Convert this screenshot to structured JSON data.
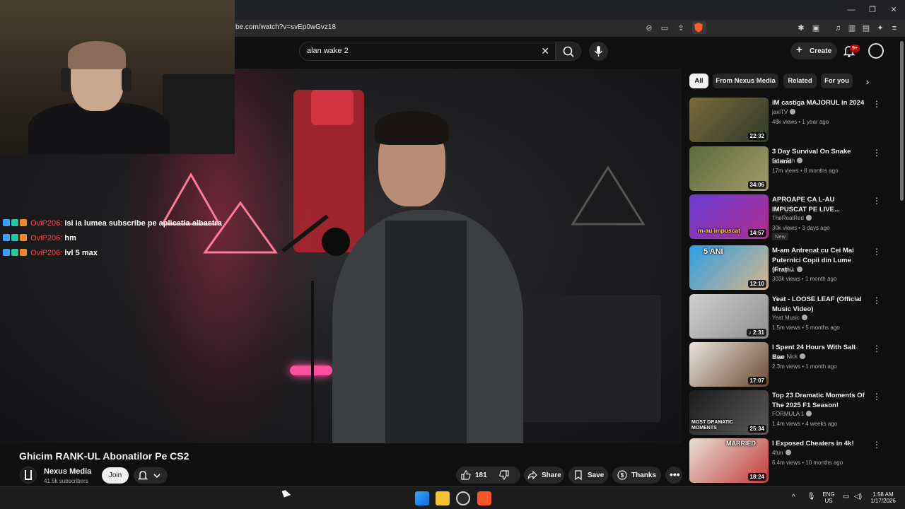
{
  "browser": {
    "url": "be.com/watch?v=svEp0wGvz18"
  },
  "search": {
    "query": "alan wake 2"
  },
  "header": {
    "create_label": "Create",
    "notification_count": "9+"
  },
  "chat": [
    {
      "user": "OviP206:",
      "message": "isi ia lumea subscribe pe aplicatia albastra"
    },
    {
      "user": "OviP206:",
      "message": "hm"
    },
    {
      "user": "OviP206:",
      "message": "lvl 5 max"
    }
  ],
  "video": {
    "title": "Ghicim RANK-UL Abonatilor Pe CS2",
    "channel": "Nexus Media",
    "subscribers": "41.5k subscribers",
    "join_label": "Join",
    "likes": "181",
    "share_label": "Share",
    "save_label": "Save",
    "thanks_label": "Thanks"
  },
  "chips": [
    {
      "label": "All"
    },
    {
      "label": "From Nexus Media"
    },
    {
      "label": "Related"
    },
    {
      "label": "For you"
    }
  ],
  "recommendations": [
    {
      "title": "iM castiga MAJORUL in 2024",
      "channel": "jaxiTV",
      "meta": "48k views • 1 year ago",
      "duration": "22:32",
      "thumb_colors": [
        "#7a6a3a",
        "#2f3a2a"
      ]
    },
    {
      "title": "3 Day Survival On Snake Island",
      "channel": "Dara Tah",
      "meta": "17m views • 8 months ago",
      "duration": "34:06",
      "thumb_colors": [
        "#5c6b3a",
        "#a39a6a"
      ]
    },
    {
      "title": "APROAPE CA L-AU IMPUSCAT PE LIVE...",
      "channel": "TheRealRed",
      "meta": "30k views • 3 days ago",
      "duration": "14:57",
      "thumb_colors": [
        "#6a3bd6",
        "#b02f8e"
      ],
      "overlay_text": "m-au impuscat",
      "new_label": "New"
    },
    {
      "title": "M-am Antrenat cu Cei Mai Puternici Copii din Lume (Frați...",
      "channel": "tony saik",
      "meta": "303k views • 1 month ago",
      "duration": "12:10",
      "thumb_colors": [
        "#2aa0e6",
        "#d9b48a"
      ],
      "overlay_text": "5 ANI"
    },
    {
      "title": "Yeat - LOOSE LEAF (Official Music Video)",
      "channel": "Yeat Music",
      "meta": "1.5m views • 5 months ago",
      "duration": "2:31",
      "thumb_colors": [
        "#cfcfcf",
        "#8f8f8f"
      ]
    },
    {
      "title": "I Spent 24 Hours With Salt Bae",
      "channel": "More Nick",
      "meta": "2.3m views • 1 month ago",
      "duration": "17:07",
      "thumb_colors": [
        "#e9e4dc",
        "#6b4a34"
      ]
    },
    {
      "title": "Top 23 Dramatic Moments Of The 2025 F1 Season!",
      "channel": "FORMULA 1",
      "meta": "1.4m views • 4 weeks ago",
      "duration": "25:34",
      "thumb_colors": [
        "#1c1c1c",
        "#5a5a5a"
      ],
      "overlay_text": "MOST DRAMATIC MOMENTS"
    },
    {
      "title": "I Exposed Cheaters in 4k!",
      "channel": "4fun",
      "meta": "6.4m views • 10 months ago",
      "duration": "18:24",
      "thumb_colors": [
        "#e8e0d6",
        "#c13a3a"
      ],
      "overlay_text": "MARRIED"
    }
  ],
  "taskbar": {
    "lang_top": "ENG",
    "lang_bottom": "US",
    "time": "1:58 AM",
    "date": "1/17/2026"
  }
}
